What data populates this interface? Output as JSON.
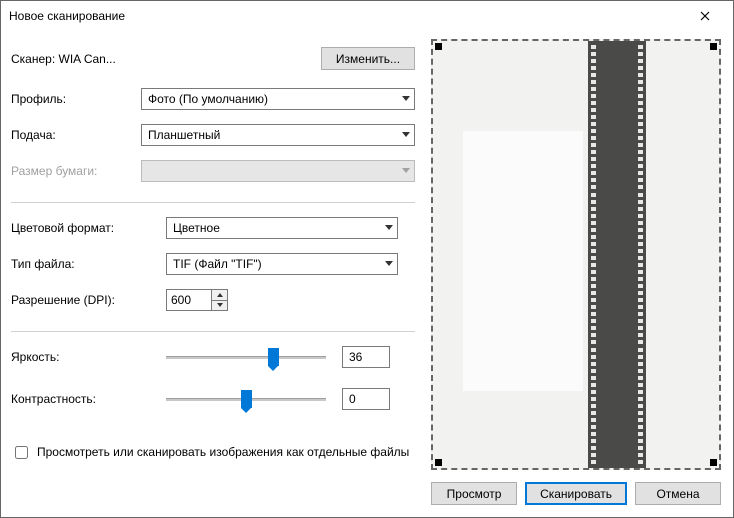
{
  "window": {
    "title": "Новое сканирование"
  },
  "scanner": {
    "label": "Сканер: WIA Can...",
    "change_btn": "Изменить..."
  },
  "profile": {
    "label": "Профиль:",
    "value": "Фото (По умолчанию)"
  },
  "source": {
    "label": "Подача:",
    "value": "Планшетный"
  },
  "paper": {
    "label": "Размер бумаги:",
    "value": ""
  },
  "color": {
    "label": "Цветовой формат:",
    "value": "Цветное"
  },
  "filetype": {
    "label": "Тип файла:",
    "value": "TIF (Файл \"TIF\")"
  },
  "dpi": {
    "label": "Разрешение (DPI):",
    "value": "600"
  },
  "brightness": {
    "label": "Яркость:",
    "value": "36",
    "percent": 68
  },
  "contrast": {
    "label": "Контрастность:",
    "value": "0",
    "percent": 50
  },
  "separate": {
    "label": "Просмотреть или сканировать изображения как отдельные файлы"
  },
  "buttons": {
    "preview": "Просмотр",
    "scan": "Сканировать",
    "cancel": "Отмена"
  }
}
